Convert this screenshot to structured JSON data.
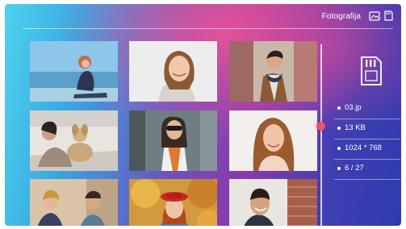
{
  "header": {
    "title": "Fotografija",
    "icons": [
      "image-folder-icon",
      "sd-card-icon"
    ]
  },
  "gallery": {
    "photos": [
      {
        "subject": "woman sitting by the sea"
      },
      {
        "subject": "smiling woman in white sweater"
      },
      {
        "subject": "man with scarf in city"
      },
      {
        "subject": "woman with dog on sofa"
      },
      {
        "subject": "woman with sunglasses on street"
      },
      {
        "subject": "woman with long curly hair"
      },
      {
        "subject": "couple at cafe with phone"
      },
      {
        "subject": "woman in red beret in autumn"
      },
      {
        "subject": "smiling man by brick wall"
      }
    ]
  },
  "sidebar": {
    "storage_icon": "sd-card-icon",
    "info": {
      "filename": "03.jp",
      "size": "13 KB",
      "resolution": "1024 * 768",
      "index": "6 / 27"
    }
  },
  "scroll_position": 0.43
}
